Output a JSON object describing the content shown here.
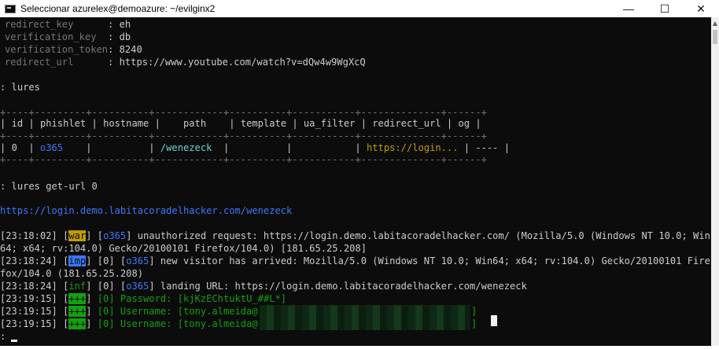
{
  "window": {
    "title": "Seleccionar azurelex@demoazure: ~/evilginx2",
    "minimize": "—",
    "maximize": "☐",
    "close": "✕"
  },
  "terminal": {
    "params": [
      {
        "key": "redirect_key",
        "sep": "      : ",
        "value": "eh"
      },
      {
        "key": "verification_key",
        "sep": "  : ",
        "value": "db"
      },
      {
        "key": "verification_token",
        "sep": ": ",
        "value": "8240"
      },
      {
        "key": "redirect_url",
        "sep": "      : ",
        "value": "https://www.youtube.com/watch?v=dQw4w9WgXcQ"
      }
    ],
    "cmd1": ": lures",
    "table": {
      "border": "+----+---------+----------+------------+----------+-----------+--------------+------+",
      "headers": [
        "id",
        "phishlet",
        "hostname",
        "path",
        "template",
        "ua_filter",
        "redirect_url",
        "og"
      ],
      "row": {
        "id": "0",
        "phishlet": "o365",
        "hostname": "",
        "path": "/wenezeck",
        "template": "",
        "ua_filter": "",
        "redirect_url": "https://login...",
        "og": "----"
      }
    },
    "cmd2": ": lures get-url 0",
    "lure_url": "https://login.demo.labitacoradelhacker.com/wenezeck",
    "logs": {
      "l1": {
        "ts": "[23:18:02]",
        "tag": "war",
        "phish": "o365",
        "msg": " unauthorized request: https://login.demo.labitacoradelhacker.com/ (Mozilla/5.0 (Windows NT 10.0; Win"
      },
      "l1b": "64; x64; rv:104.0) Gecko/20100101 Firefox/104.0) [181.65.25.208]",
      "l2": {
        "ts": "[23:18:24]",
        "tag": "imp",
        "id": "0",
        "phish": "o365",
        "msg": " new visitor has arrived: Mozilla/5.0 (Windows NT 10.0; Win64; x64; rv:104.0) Gecko/20100101 Fire"
      },
      "l2b": "fox/104.0 (181.65.25.208)",
      "l3": {
        "ts": "[23:18:24]",
        "tag": "inf",
        "id": "0",
        "phish": "o365",
        "msg": " landing URL: https://login.demo.labitacoradelhacker.com/wenezeck"
      },
      "l4": {
        "ts": "[23:19:15]",
        "tag": "+++",
        "msg": "[0] Password: [kjKzEChtuktU_##L*]"
      },
      "l5": {
        "ts": "[23:19:15]",
        "tag": "+++",
        "msg": "[0] Username: [tony.almeida@",
        "end": "]"
      },
      "l6": {
        "ts": "[23:19:15]",
        "tag": "+++",
        "msg": "[0] Username: [tony.almeida@",
        "end": "]"
      }
    },
    "prompt": ":"
  }
}
